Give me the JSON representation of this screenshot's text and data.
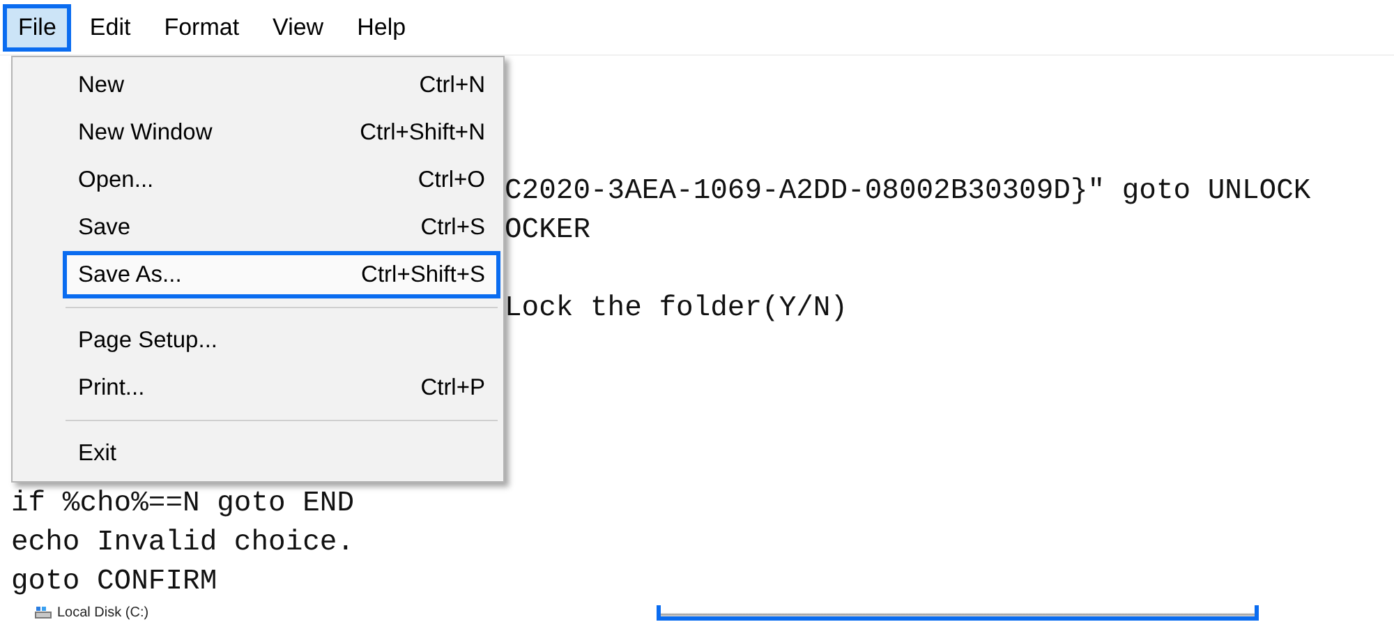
{
  "menubar": [
    {
      "label": "File",
      "selected": true
    },
    {
      "label": "Edit",
      "selected": false
    },
    {
      "label": "Format",
      "selected": false
    },
    {
      "label": "View",
      "selected": false
    },
    {
      "label": "Help",
      "selected": false
    }
  ],
  "file_menu": [
    {
      "kind": "item",
      "label": "New",
      "shortcut": "Ctrl+N",
      "selected": false
    },
    {
      "kind": "item",
      "label": "New Window",
      "shortcut": "Ctrl+Shift+N",
      "selected": false
    },
    {
      "kind": "item",
      "label": "Open...",
      "shortcut": "Ctrl+O",
      "selected": false
    },
    {
      "kind": "item",
      "label": "Save",
      "shortcut": "Ctrl+S",
      "selected": false
    },
    {
      "kind": "item",
      "label": "Save As...",
      "shortcut": "Ctrl+Shift+S",
      "selected": true
    },
    {
      "kind": "separator"
    },
    {
      "kind": "item",
      "label": "Page Setup...",
      "selected": false
    },
    {
      "kind": "item",
      "label": "Print...",
      "shortcut": "Ctrl+P",
      "selected": false
    },
    {
      "kind": "separator"
    },
    {
      "kind": "item",
      "label": "Exit",
      "selected": false
    }
  ],
  "editor_lines": [
    {
      "kind": "blank"
    },
    {
      "kind": "blank"
    },
    {
      "kind": "blank"
    },
    {
      "kind": "behind-menu",
      "text": "C2020-3AEA-1069-A2DD-08002B30309D}\" goto UNLOCK"
    },
    {
      "kind": "behind-menu",
      "text": "OCKER"
    },
    {
      "kind": "blank"
    },
    {
      "kind": "behind-menu",
      "text": "Lock the folder(Y/N)"
    },
    {
      "kind": "blank"
    },
    {
      "kind": "blank"
    },
    {
      "kind": "blank"
    },
    {
      "kind": "blank"
    },
    {
      "kind": "full",
      "text": "if %cho%==N goto END"
    },
    {
      "kind": "full",
      "text": "echo Invalid choice."
    },
    {
      "kind": "full",
      "text": "goto CONFIRM"
    }
  ],
  "bottom_strip": {
    "drive_label": "Local Disk (C:)"
  }
}
